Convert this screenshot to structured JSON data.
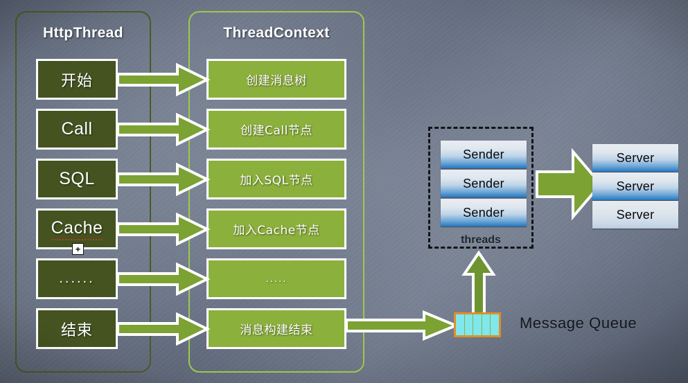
{
  "groups": {
    "http_thread": {
      "title": "HttpThread"
    },
    "thread_context": {
      "title": "ThreadContext"
    }
  },
  "http_steps": [
    {
      "label": "开始",
      "kind": "han"
    },
    {
      "label": "Call",
      "kind": "latin"
    },
    {
      "label": "SQL",
      "kind": "latin"
    },
    {
      "label": "Cache",
      "kind": "latin-misspelled"
    },
    {
      "label": "......",
      "kind": "dots"
    },
    {
      "label": "结束",
      "kind": "han"
    }
  ],
  "context_steps": [
    {
      "label": "创建消息树",
      "kind": "han"
    },
    {
      "label": "创建Call节点",
      "kind": "han"
    },
    {
      "label": "加入SQL节点",
      "kind": "han"
    },
    {
      "label": "加入Cache节点",
      "kind": "han"
    },
    {
      "label": ".....",
      "kind": "dots"
    },
    {
      "label": "消息构建结束",
      "kind": "han"
    }
  ],
  "threads": {
    "label": "threads",
    "items": [
      "Sender",
      "Sender",
      "Sender"
    ]
  },
  "servers": {
    "items": [
      "Server",
      "Server",
      "Server"
    ]
  },
  "message_queue": {
    "label": "Message Queue",
    "cells": 5
  },
  "cursor": {
    "glyph": "+"
  },
  "colors": {
    "background_slate": "#6b7486",
    "dark_box": "#445320",
    "light_box": "#8cb03c",
    "arrow_green": "#7ba233",
    "arrow_outline": "#ffffff",
    "group_border_dark": "#4a5a22",
    "group_border_light": "#9ec94a",
    "queue_fill": "#7ee8ee",
    "queue_border": "#e08f2a",
    "chip_blue": "#2f7fc4",
    "dashed_border": "#111417"
  }
}
